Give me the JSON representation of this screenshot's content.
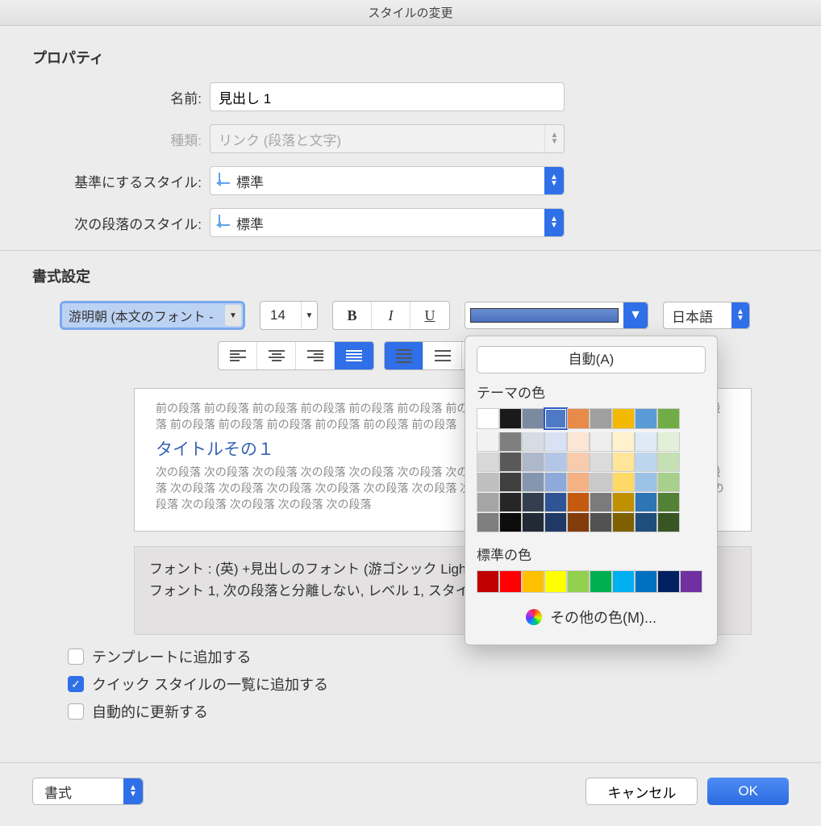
{
  "window": {
    "title": "スタイルの変更"
  },
  "properties": {
    "heading": "プロパティ",
    "name_label": "名前:",
    "name_value": "見出し 1",
    "type_label": "種類:",
    "type_value": "リンク (段落と文字)",
    "base_label": "基準にするスタイル:",
    "base_value": "標準",
    "next_label": "次の段落のスタイル:",
    "next_value": "標準"
  },
  "formatting": {
    "heading": "書式設定",
    "font_name": "游明朝 (本文のフォント -",
    "font_size": "14",
    "bold": "B",
    "italic": "I",
    "underline": "U",
    "language": "日本語"
  },
  "preview": {
    "before": "前の段落 前の段落 前の段落 前の段落 前の段落 前の段落 前の段落 前の段落 前の段落 前の段落 前の段落 前の段落 前の段落 前の段落 前の段落 前の段落 前の段落 前の段落",
    "sample": "タイトルその１",
    "after": "次の段落 次の段落 次の段落 次の段落 次の段落 次の段落 次の段落 次の段落 次の段落 次の段落 次の段落 次の段落 次の段落 次の段落 次の段落 次の段落 次の段落 次の段落 次の段落 次の段落 次の段落 次の段落 次の段落 次の段落 次の段落 次の段落 次の段落 次の段落"
  },
  "description": "フォント : (英) +見出しのフォント (游ゴシック Light), (日) +見出しのフォント - 日本語, 太字, フォント 1, 次の段落と分離しない, レベル 1, スタイル: 表示, 優先度: 10\n     基準: 標準",
  "checks": {
    "template": "テンプレートに追加する",
    "quickstyle": "クイック スタイルの一覧に追加する",
    "autoupdate": "自動的に更新する",
    "quickstyle_checked": true
  },
  "footer": {
    "format": "書式",
    "cancel": "キャンセル",
    "ok": "OK"
  },
  "popup": {
    "auto": "自動(A)",
    "theme_label": "テーマの色",
    "standard_label": "標準の色",
    "more": "その他の色(M)...",
    "theme_colors": [
      "#ffffff",
      "#000000",
      "#44546a",
      "#4472c4",
      "#ed7d31",
      "#a5a5a5",
      "#ffc000",
      "#5b9bd5",
      "#70ad47",
      "#70ad47"
    ],
    "theme_row1": [
      "#ffffff",
      "#1a1a1a",
      "#7b8aa1",
      "#4e79c6",
      "#e88b4a",
      "#9f9f9f",
      "#f2b900",
      "#5b9bd5",
      "#70ad47"
    ],
    "shade_rows": [
      [
        "#f2f2f2",
        "#7f7f7f",
        "#d6dbe4",
        "#d9e2f3",
        "#fbe5d5",
        "#ededed",
        "#fff2cc",
        "#deebf6",
        "#e2efd9"
      ],
      [
        "#d8d8d8",
        "#595959",
        "#adb8ca",
        "#b4c6e7",
        "#f7cbab",
        "#dbdbdb",
        "#fee599",
        "#bdd6ee",
        "#c5e0b3"
      ],
      [
        "#bfbfbf",
        "#3f3f3f",
        "#8496b0",
        "#8eaadb",
        "#f4b183",
        "#c9c9c9",
        "#ffd965",
        "#9cc2e5",
        "#a8d08d"
      ],
      [
        "#a5a5a5",
        "#262626",
        "#333f4f",
        "#2f5496",
        "#c45a10",
        "#7b7b7b",
        "#bf9000",
        "#2e75b5",
        "#538135"
      ],
      [
        "#7f7f7f",
        "#0c0c0c",
        "#222a35",
        "#1f3864",
        "#833c0b",
        "#525252",
        "#7f6000",
        "#1e4e79",
        "#375623"
      ]
    ],
    "standard_colors": [
      "#c00000",
      "#ff0000",
      "#ffc000",
      "#ffff00",
      "#92d050",
      "#00b050",
      "#00b0f0",
      "#0070c0",
      "#002060",
      "#7030a0"
    ],
    "selected_theme_index": 3
  }
}
